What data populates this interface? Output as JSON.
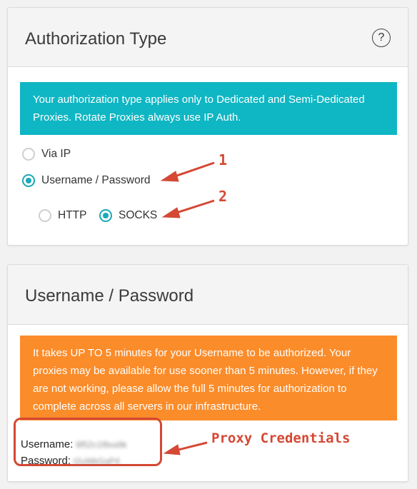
{
  "auth_card": {
    "title": "Authorization Type",
    "help_glyph": "?",
    "notice": "Your authorization type applies only to Dedicated and Semi-Dedicated Proxies. Rotate Proxies always use IP Auth.",
    "notice_color": "#0fb6c3",
    "options": {
      "via_ip": {
        "label": "Via IP",
        "checked": false
      },
      "username_password": {
        "label": "Username / Password",
        "checked": true
      }
    },
    "protocols": {
      "http": {
        "label": "HTTP",
        "checked": false
      },
      "socks": {
        "label": "SOCKS",
        "checked": true
      }
    }
  },
  "creds_card": {
    "title": "Username / Password",
    "notice": "It takes UP TO 5 minutes for your Username to be authorized. Your proxies may be available for use sooner than 5 minutes. However, if they are not working, please allow the full 5 minutes for authorization to complete across all servers in our infrastructure.",
    "notice_color": "#fb8c2a",
    "username_label": "Username:",
    "username_value": "8f52c1f8xa9k",
    "password_label": "Password:",
    "password_value": "t2uWkGaP4",
    "values_obscured": true
  },
  "annotations": {
    "step1": "1",
    "step2": "2",
    "credentials_label": "Proxy Credentials",
    "color": "#d44834"
  },
  "accent_color": "#1aa9b8"
}
